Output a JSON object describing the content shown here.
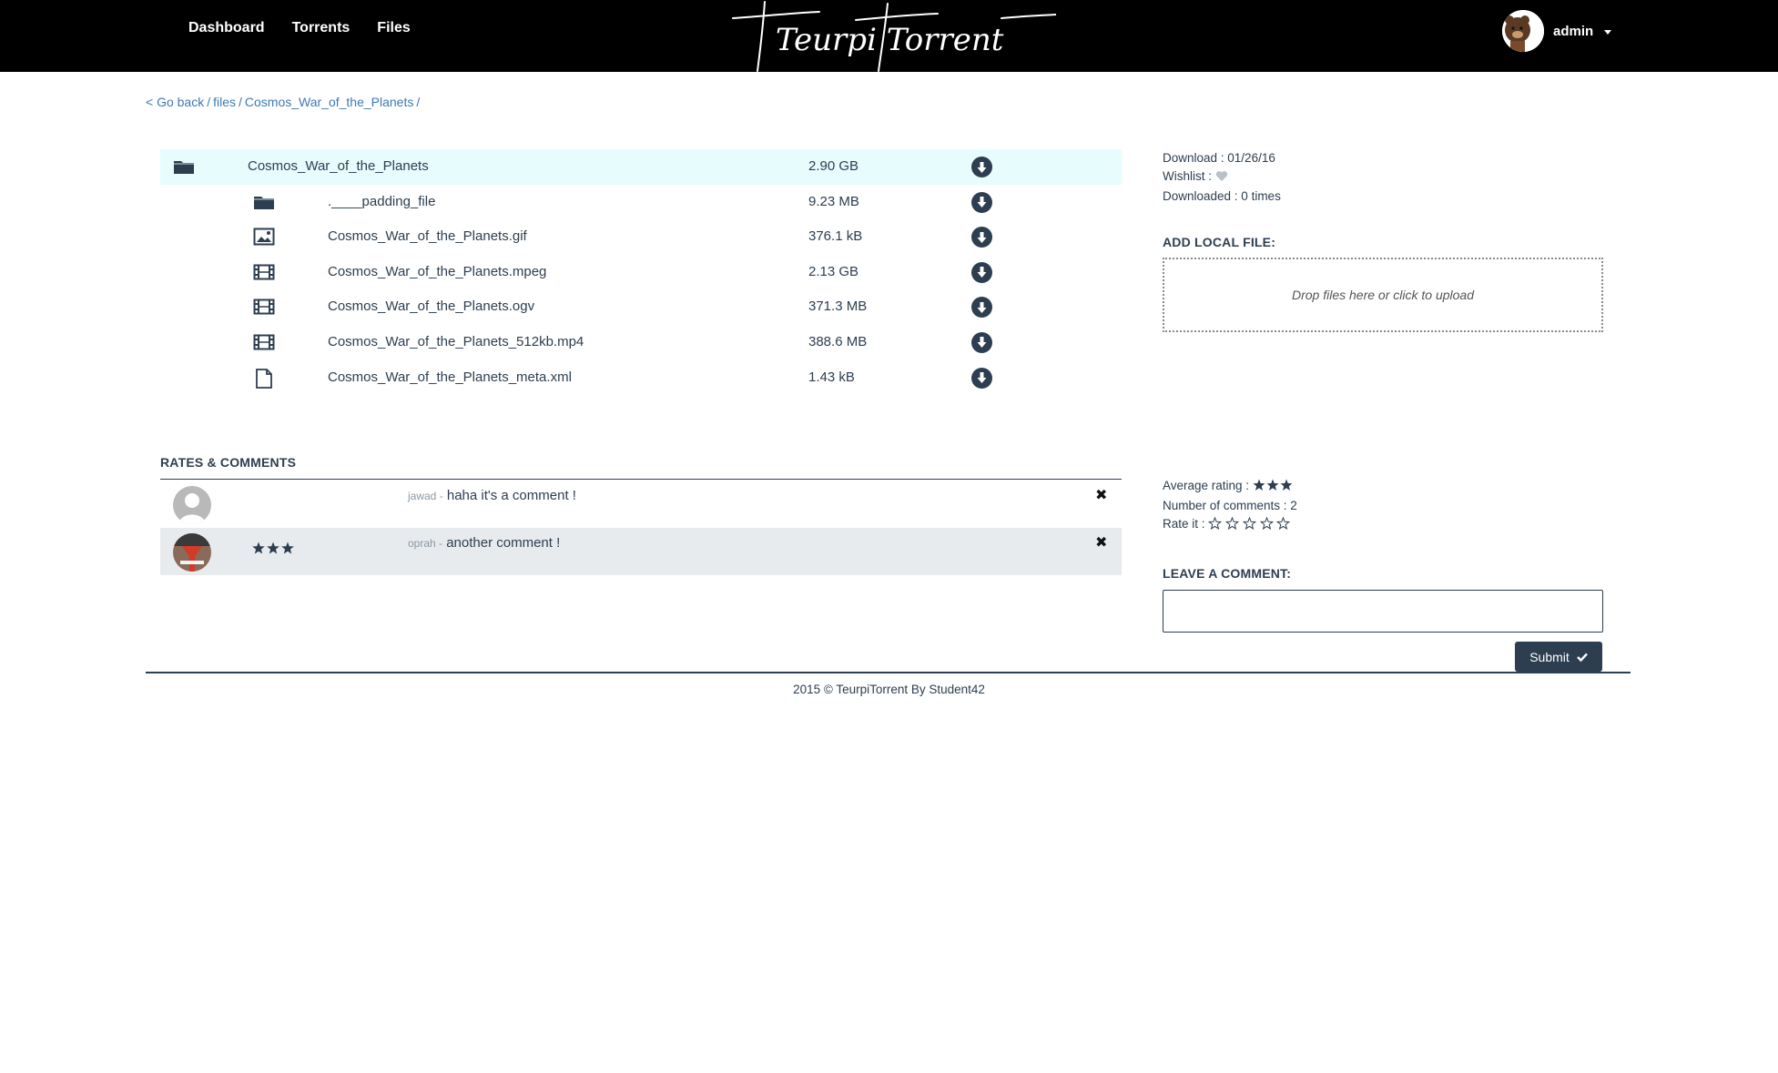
{
  "nav": {
    "links": [
      "Dashboard",
      "Torrents",
      "Files"
    ],
    "brand": "Teurpi Torrent",
    "user": "admin"
  },
  "breadcrumb": {
    "back": "< Go back",
    "items": [
      "files",
      "Cosmos_War_of_the_Planets"
    ]
  },
  "files": {
    "root": {
      "name": "Cosmos_War_of_the_Planets",
      "size": "2.90 GB",
      "icon": "folder-icon"
    },
    "children": [
      {
        "name": ".____padding_file",
        "size": "9.23 MB",
        "icon": "folder-icon"
      },
      {
        "name": "Cosmos_War_of_the_Planets.gif",
        "size": "376.1 kB",
        "icon": "image-icon"
      },
      {
        "name": "Cosmos_War_of_the_Planets.mpeg",
        "size": "2.13 GB",
        "icon": "film-icon"
      },
      {
        "name": "Cosmos_War_of_the_Planets.ogv",
        "size": "371.3 MB",
        "icon": "film-icon"
      },
      {
        "name": "Cosmos_War_of_the_Planets_512kb.mp4",
        "size": "388.6 MB",
        "icon": "film-icon"
      },
      {
        "name": "Cosmos_War_of_the_Planets_meta.xml",
        "size": "1.43 kB",
        "icon": "file-icon"
      }
    ]
  },
  "info": {
    "download_label": "Download : 01/26/16",
    "wishlist_label": "Wishlist :",
    "downloaded_label": "Downloaded : 0 times"
  },
  "upload": {
    "title": "ADD LOCAL FILE:",
    "placeholder": "Drop files here or click to upload"
  },
  "comments": {
    "title": "RATES & COMMENTS",
    "items": [
      {
        "user": "jawad -",
        "text": "haha it's a comment !",
        "stars": 0
      },
      {
        "user": "oprah -",
        "text": "another comment !",
        "stars": 3
      }
    ]
  },
  "rating": {
    "average_label": "Average rating :",
    "average_stars": 3,
    "count_label": "Number of comments : 2",
    "rate_label": "Rate it :"
  },
  "leave_comment": {
    "title": "LEAVE A COMMENT:",
    "submit": "Submit"
  },
  "footer": {
    "prefix": "2015 © ",
    "link": "TeurpiTorrent",
    "suffix": " By Student42"
  },
  "colors": {
    "navy": "#2d3e50",
    "highlight": "#e6fcfd",
    "link": "#3f79b5"
  }
}
